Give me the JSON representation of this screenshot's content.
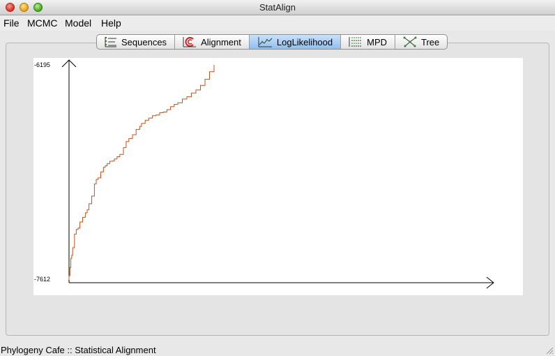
{
  "window": {
    "title": "StatAlign"
  },
  "menu": [
    "File",
    "MCMC",
    "Model",
    "Help"
  ],
  "tabs": [
    {
      "label": "Sequences",
      "icon": "sequences-icon"
    },
    {
      "label": "Alignment",
      "icon": "alignment-icon"
    },
    {
      "label": "LogLikelihood",
      "icon": "loglikelihood-icon",
      "active": true
    },
    {
      "label": "MPD",
      "icon": "mpd-icon"
    },
    {
      "label": "Tree",
      "icon": "tree-icon"
    }
  ],
  "chart_data": {
    "type": "line",
    "y_tick_labels": [
      "-6195",
      "-7612"
    ],
    "ylim": [
      -7612,
      -6195
    ],
    "line_color": "#c8501a",
    "x": [
      0,
      1,
      2,
      3,
      4,
      6,
      8,
      10,
      12,
      15,
      18,
      20,
      22,
      25,
      28,
      30,
      32,
      35,
      38,
      40,
      42,
      45,
      48,
      50,
      53,
      56,
      60,
      63,
      66,
      70,
      74,
      78,
      80,
      84,
      88,
      92,
      96,
      100,
      104,
      108,
      112,
      116,
      120,
      125,
      130,
      135,
      140,
      145,
      150,
      155,
      160
    ],
    "y": [
      -7585,
      -7530,
      -7470,
      -7450,
      -7400,
      -7310,
      -7280,
      -7270,
      -7230,
      -7200,
      -7170,
      -7150,
      -7110,
      -7060,
      -6980,
      -6950,
      -6940,
      -6900,
      -6870,
      -6860,
      -6845,
      -6830,
      -6828,
      -6815,
      -6800,
      -6785,
      -6740,
      -6700,
      -6680,
      -6655,
      -6620,
      -6600,
      -6580,
      -6560,
      -6545,
      -6530,
      -6525,
      -6510,
      -6505,
      -6490,
      -6470,
      -6455,
      -6445,
      -6420,
      -6405,
      -6380,
      -6360,
      -6330,
      -6290,
      -6240,
      -6195
    ]
  },
  "status": {
    "text": "Phylogeny Cafe :: Statistical Alignment"
  }
}
